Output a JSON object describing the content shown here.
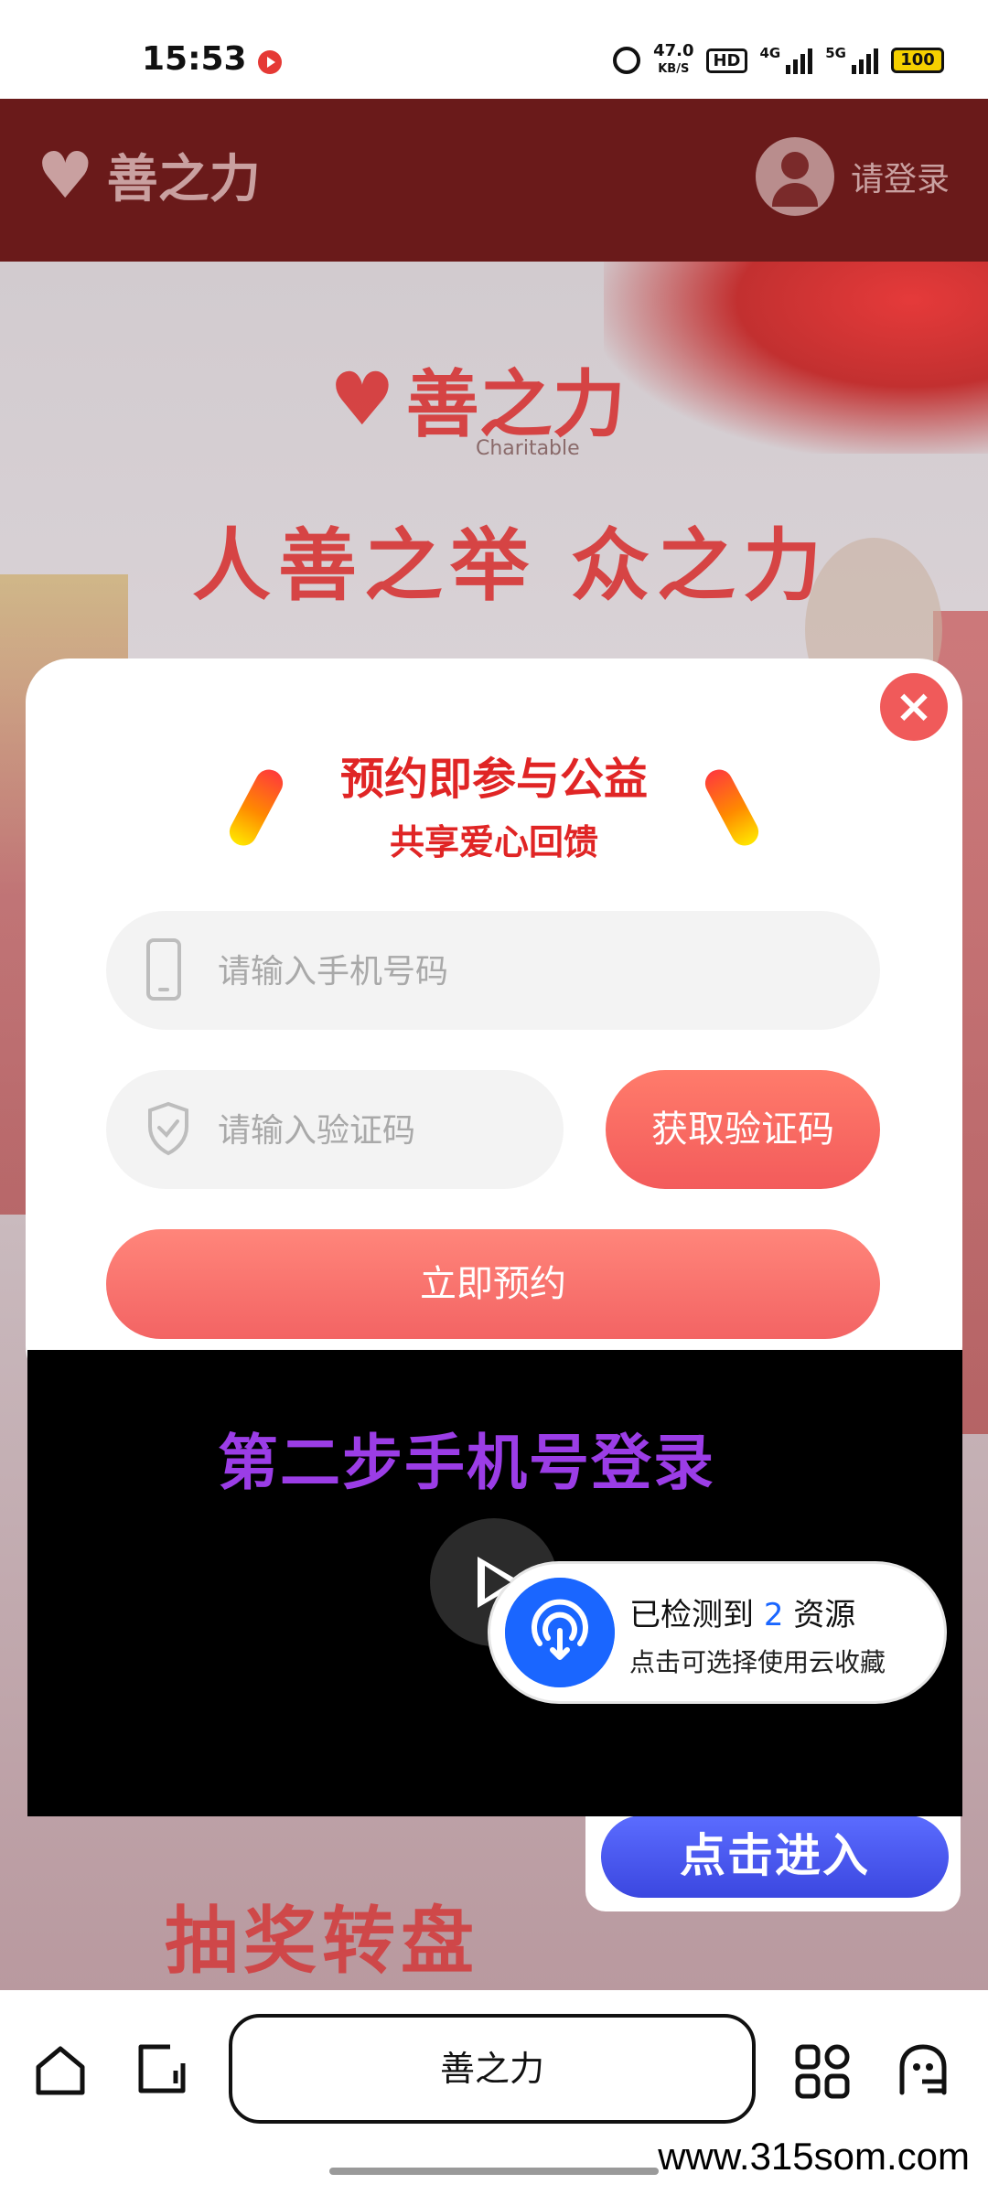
{
  "status_bar": {
    "time": "15:53",
    "net_speed_value": "47.0",
    "net_speed_unit": "KB/S",
    "hd_label": "HD",
    "net1": "4G",
    "net2": "5G",
    "battery": "100"
  },
  "site": {
    "logo_text": "善之力",
    "login_label": "请登录",
    "banner_logo": "善之力",
    "banner_sub": "Charitable",
    "banner_slogan": "人善之举 众之力",
    "lottery_title": "抽奖转盘"
  },
  "modal": {
    "title": "预约即参与公益",
    "subtitle": "共享爱心回馈",
    "phone_placeholder": "请输入手机号码",
    "code_placeholder": "请输入验证码",
    "get_code_label": "获取验证码",
    "submit_label": "立即预约",
    "close_glyph": "×"
  },
  "video": {
    "caption": "第二步手机号登录"
  },
  "detect_popup": {
    "prefix": "已检测到 ",
    "count": "2",
    "suffix": " 资源",
    "line2": "点击可选择使用云收藏"
  },
  "floating": {
    "enter_label": "点击进入"
  },
  "browser": {
    "url_title": "善之力"
  },
  "watermark": "www.315som.com",
  "colors": {
    "brand_red": "#e02525",
    "button_red": "#f36464",
    "header_dark_red": "#6a1a1a",
    "popup_blue": "#1a66ff",
    "caption_purple": "#9b3de6"
  },
  "icons": [
    "alarm-icon",
    "record-icon",
    "phone-icon",
    "shield-icon",
    "close-icon",
    "play-icon",
    "cloud-detect-icon",
    "home-icon",
    "tabs-icon",
    "apps-icon",
    "ghost-icon"
  ]
}
